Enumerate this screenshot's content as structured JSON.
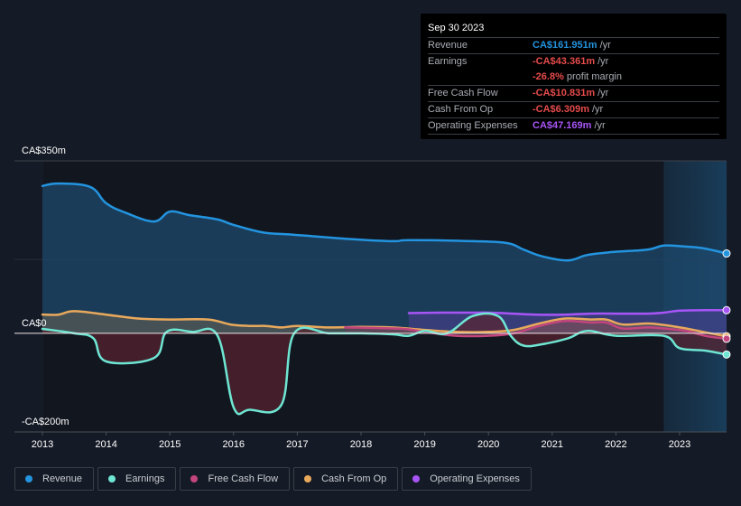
{
  "tooltip": {
    "date": "Sep 30 2023",
    "rows": [
      {
        "label": "Revenue",
        "value": "CA$161.951m",
        "suffix": "/yr",
        "color": "#2394df"
      },
      {
        "label": "Earnings",
        "value": "-CA$43.361m",
        "suffix": "/yr",
        "color": "#e64b4b"
      },
      {
        "label": "",
        "value": "-26.8%",
        "suffix": "profit margin",
        "color": "#e64b4b"
      },
      {
        "label": "Free Cash Flow",
        "value": "-CA$10.831m",
        "suffix": "/yr",
        "color": "#e64b4b"
      },
      {
        "label": "Cash From Op",
        "value": "-CA$6.309m",
        "suffix": "/yr",
        "color": "#e64b4b"
      },
      {
        "label": "Operating Expenses",
        "value": "CA$47.169m",
        "suffix": "/yr",
        "color": "#a855f7"
      }
    ]
  },
  "legend": [
    {
      "label": "Revenue",
      "color": "#2394df"
    },
    {
      "label": "Earnings",
      "color": "#6ee6d3"
    },
    {
      "label": "Free Cash Flow",
      "color": "#c2457e"
    },
    {
      "label": "Cash From Op",
      "color": "#e9a95c"
    },
    {
      "label": "Operating Expenses",
      "color": "#a855f7"
    }
  ],
  "chart_data": {
    "type": "area",
    "title": "",
    "xlabel": "",
    "ylabel": "",
    "ylim": [
      -200,
      350
    ],
    "xlim": [
      2013.0,
      2023.75
    ],
    "y_tick_labels": [
      {
        "value": 350,
        "label": "CA$350m"
      },
      {
        "value": 0,
        "label": "CA$0"
      },
      {
        "value": -200,
        "label": "-CA$200m"
      }
    ],
    "x_ticks": [
      2013,
      2014,
      2015,
      2016,
      2017,
      2018,
      2019,
      2020,
      2021,
      2022,
      2023
    ],
    "x_tick_labels": [
      "2013",
      "2014",
      "2015",
      "2016",
      "2017",
      "2018",
      "2019",
      "2020",
      "2021",
      "2022",
      "2023"
    ],
    "gridlines": [
      350,
      150,
      0
    ],
    "highlight_from": 2022.75,
    "units": "CA$ millions",
    "series": [
      {
        "name": "Revenue",
        "color": "#2394df",
        "fill": true,
        "x": [
          2013.0,
          2013.25,
          2013.75,
          2014.0,
          2014.3,
          2014.75,
          2015.0,
          2015.3,
          2015.75,
          2016.0,
          2016.45,
          2016.85,
          2017.15,
          2017.75,
          2018.5,
          2018.75,
          2019.75,
          2020.3,
          2020.55,
          2020.85,
          2021.25,
          2021.55,
          2021.95,
          2022.5,
          2022.75,
          2023.1,
          2023.4,
          2023.75
        ],
        "values": [
          299,
          304,
          297,
          264,
          245,
          227,
          247,
          240,
          231,
          220,
          205,
          201,
          198,
          192,
          187,
          189,
          187,
          183,
          170,
          156,
          148,
          159,
          165,
          170,
          178,
          176,
          172,
          162
        ]
      },
      {
        "name": "Earnings",
        "color": "#6ee6d3",
        "fill": true,
        "x": [
          2013.0,
          2013.5,
          2013.8,
          2014.0,
          2014.75,
          2014.95,
          2015.35,
          2015.75,
          2016.0,
          2016.25,
          2016.75,
          2016.95,
          2017.5,
          2018.0,
          2018.5,
          2018.75,
          2019.0,
          2019.35,
          2019.75,
          2020.15,
          2020.35,
          2020.55,
          2020.85,
          2021.25,
          2021.55,
          2022.0,
          2022.75,
          2023.0,
          2023.4,
          2023.75
        ],
        "values": [
          9,
          0,
          -10,
          -57,
          -50,
          3,
          3,
          -5,
          -150,
          -155,
          -145,
          0,
          0,
          0,
          -2,
          -5,
          5,
          0,
          35,
          35,
          -5,
          -25,
          -22,
          -10,
          5,
          -5,
          -5,
          -30,
          -35,
          -43
        ]
      },
      {
        "name": "Free Cash Flow",
        "color": "#c2457e",
        "fill": true,
        "x": [
          2017.75,
          2018.5,
          2018.75,
          2019.0,
          2019.5,
          2020.0,
          2020.4,
          2020.8,
          2021.2,
          2021.6,
          2021.85,
          2022.1,
          2022.5,
          2022.75,
          2023.1,
          2023.4,
          2023.75
        ],
        "values": [
          12,
          10,
          8,
          3,
          -5,
          -5,
          0,
          15,
          25,
          22,
          22,
          10,
          12,
          10,
          5,
          -5,
          -11
        ]
      },
      {
        "name": "Cash From Op",
        "color": "#e9a95c",
        "fill": true,
        "x": [
          2013.0,
          2013.25,
          2013.5,
          2014.0,
          2014.5,
          2015.0,
          2015.6,
          2015.95,
          2016.25,
          2016.5,
          2016.75,
          2017.0,
          2017.5,
          2018.0,
          2018.5,
          2019.0,
          2019.5,
          2020.0,
          2020.4,
          2020.8,
          2021.2,
          2021.6,
          2021.85,
          2022.1,
          2022.5,
          2022.75,
          2023.1,
          2023.4,
          2023.75
        ],
        "values": [
          38,
          38,
          45,
          38,
          30,
          28,
          28,
          18,
          15,
          15,
          12,
          15,
          12,
          13,
          12,
          7,
          3,
          3,
          7,
          20,
          30,
          28,
          28,
          18,
          20,
          17,
          10,
          2,
          -6
        ]
      },
      {
        "name": "Operating Expenses",
        "color": "#a855f7",
        "fill": true,
        "x": [
          2018.75,
          2019.25,
          2019.75,
          2020.0,
          2020.4,
          2020.75,
          2021.2,
          2021.6,
          2022.0,
          2022.5,
          2022.75,
          2023.0,
          2023.4,
          2023.75
        ],
        "values": [
          41,
          42,
          42,
          42,
          40,
          38,
          38,
          40,
          40,
          40,
          42,
          46,
          47,
          47
        ]
      }
    ]
  }
}
